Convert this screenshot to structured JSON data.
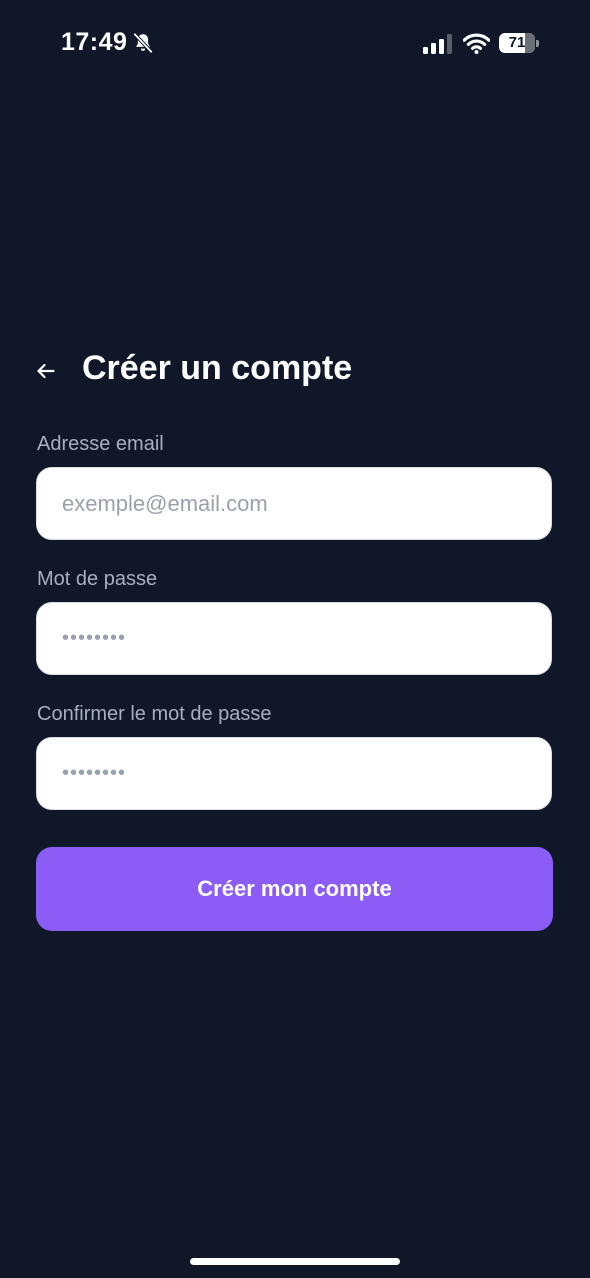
{
  "status_bar": {
    "time": "17:49",
    "battery_level": "71",
    "icons": [
      "bell-slash-icon",
      "cellular-signal-icon",
      "wifi-icon",
      "battery-icon"
    ]
  },
  "header": {
    "back_icon": "arrow-left-icon",
    "title": "Créer un compte"
  },
  "form": {
    "email": {
      "label": "Adresse email",
      "placeholder": "exemple@email.com"
    },
    "password": {
      "label": "Mot de passe",
      "masked_value": "••••••••"
    },
    "confirm_password": {
      "label": "Confirmer le mot de passe",
      "masked_value": "••••••••"
    },
    "submit_label": "Créer mon compte"
  },
  "colors": {
    "background": "#101729",
    "accent": "#8b5cf6",
    "label": "#a7afbf",
    "placeholder": "#9aa1ad"
  }
}
